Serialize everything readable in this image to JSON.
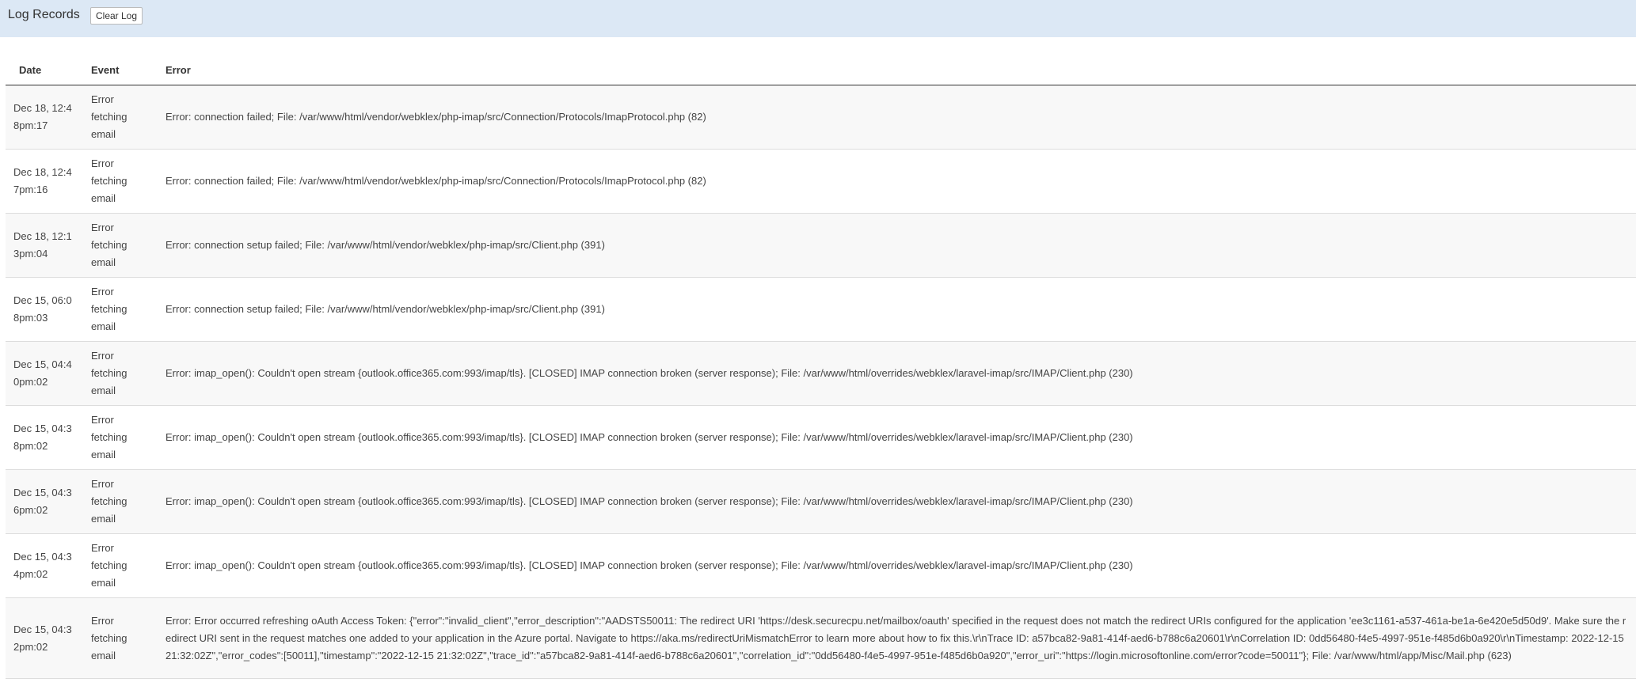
{
  "header": {
    "title": "Log Records",
    "clear_label": "Clear Log"
  },
  "columns": [
    "Date",
    "Event",
    "Error"
  ],
  "rows": [
    {
      "date": "Dec 18, 12:48pm:17",
      "event": "Error fetching email",
      "error": "Error: connection failed; File: /var/www/html/vendor/webklex/php-imap/src/Connection/Protocols/ImapProtocol.php (82)"
    },
    {
      "date": "Dec 18, 12:47pm:16",
      "event": "Error fetching email",
      "error": "Error: connection failed; File: /var/www/html/vendor/webklex/php-imap/src/Connection/Protocols/ImapProtocol.php (82)"
    },
    {
      "date": "Dec 18, 12:13pm:04",
      "event": "Error fetching email",
      "error": "Error: connection setup failed; File: /var/www/html/vendor/webklex/php-imap/src/Client.php (391)"
    },
    {
      "date": "Dec 15, 06:08pm:03",
      "event": "Error fetching email",
      "error": "Error: connection setup failed; File: /var/www/html/vendor/webklex/php-imap/src/Client.php (391)"
    },
    {
      "date": "Dec 15, 04:40pm:02",
      "event": "Error fetching email",
      "error": "Error: imap_open(): Couldn't open stream {outlook.office365.com:993/imap/tls}. [CLOSED] IMAP connection broken (server response); File: /var/www/html/overrides/webklex/laravel-imap/src/IMAP/Client.php (230)"
    },
    {
      "date": "Dec 15, 04:38pm:02",
      "event": "Error fetching email",
      "error": "Error: imap_open(): Couldn't open stream {outlook.office365.com:993/imap/tls}. [CLOSED] IMAP connection broken (server response); File: /var/www/html/overrides/webklex/laravel-imap/src/IMAP/Client.php (230)"
    },
    {
      "date": "Dec 15, 04:36pm:02",
      "event": "Error fetching email",
      "error": "Error: imap_open(): Couldn't open stream {outlook.office365.com:993/imap/tls}. [CLOSED] IMAP connection broken (server response); File: /var/www/html/overrides/webklex/laravel-imap/src/IMAP/Client.php (230)"
    },
    {
      "date": "Dec 15, 04:34pm:02",
      "event": "Error fetching email",
      "error": "Error: imap_open(): Couldn't open stream {outlook.office365.com:993/imap/tls}. [CLOSED] IMAP connection broken (server response); File: /var/www/html/overrides/webklex/laravel-imap/src/IMAP/Client.php (230)"
    },
    {
      "date": "Dec 15, 04:32pm:02",
      "event": "Error fetching email",
      "error": "Error: Error occurred refreshing oAuth Access Token: {\"error\":\"invalid_client\",\"error_description\":\"AADSTS50011: The redirect URI 'https://desk.securecpu.net/mailbox/oauth' specified in the request does not match the redirect URIs configured for the application 'ee3c1161-a537-461a-be1a-6e420e5d50d9'. Make sure the redirect URI sent in the request matches one added to your application in the Azure portal. Navigate to https://aka.ms/redirectUriMismatchError to learn more about how to fix this.\\r\\nTrace ID: a57bca82-9a81-414f-aed6-b788c6a20601\\r\\nCorrelation ID: 0dd56480-f4e5-4997-951e-f485d6b0a920\\r\\nTimestamp: 2022-12-15 21:32:02Z\",\"error_codes\":[50011],\"timestamp\":\"2022-12-15 21:32:02Z\",\"trace_id\":\"a57bca82-9a81-414f-aed6-b788c6a20601\",\"correlation_id\":\"0dd56480-f4e5-4997-951e-f485d6b0a920\",\"error_uri\":\"https://login.microsoftonline.com/error?code=50011\"}; File: /var/www/html/app/Misc/Mail.php (623)"
    }
  ]
}
